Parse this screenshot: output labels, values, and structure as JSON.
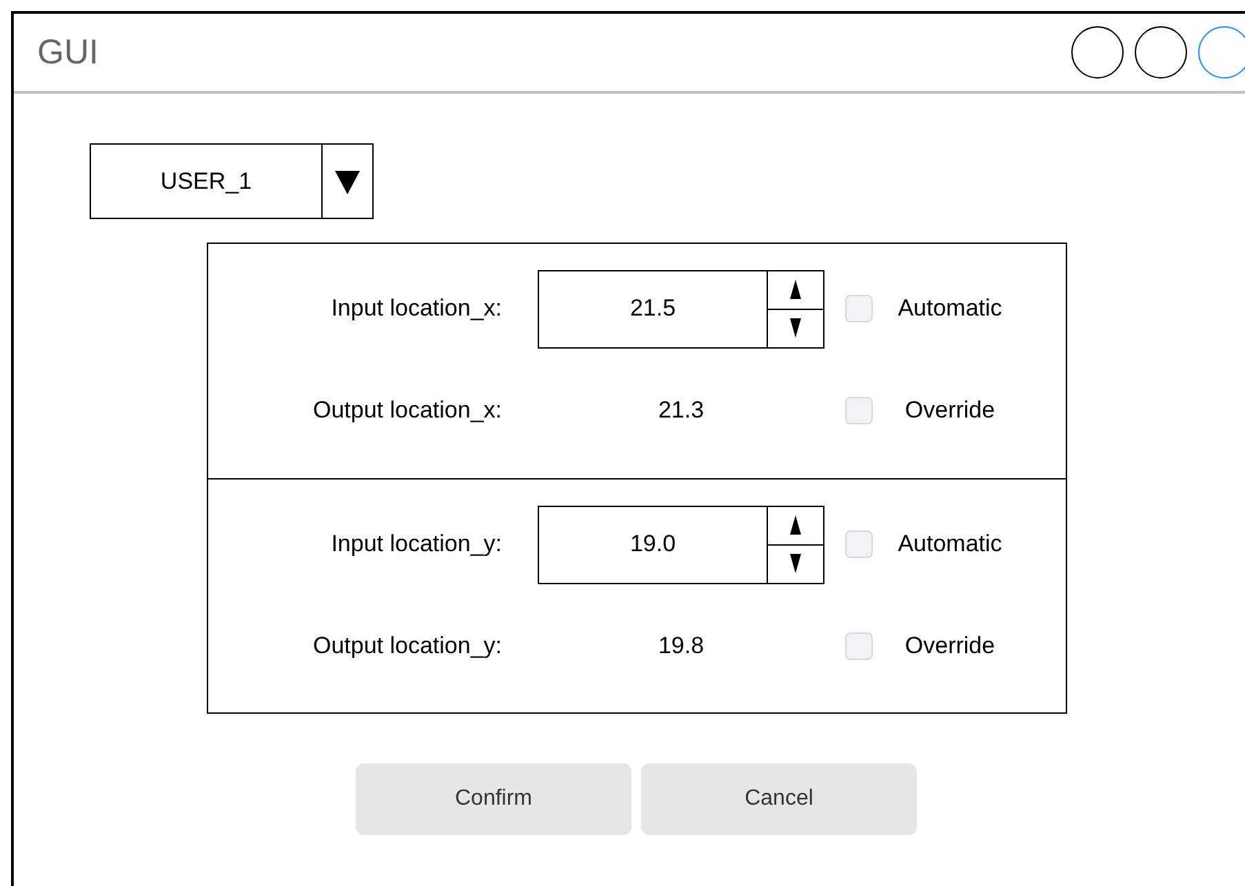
{
  "window": {
    "title": "GUI"
  },
  "user_dropdown": {
    "value": "USER_1"
  },
  "sections": [
    {
      "input": {
        "label": "Input location_x:",
        "value": "21.5"
      },
      "automatic": {
        "label": "Automatic",
        "checked": false
      },
      "output": {
        "label": "Output location_x:",
        "value": "21.3"
      },
      "override": {
        "label": "Override",
        "checked": false
      }
    },
    {
      "input": {
        "label": "Input location_y:",
        "value": "19.0"
      },
      "automatic": {
        "label": "Automatic",
        "checked": false
      },
      "output": {
        "label": "Output location_y:",
        "value": "19.8"
      },
      "override": {
        "label": "Override",
        "checked": false
      }
    }
  ],
  "buttons": [
    "Confirm",
    "Cancel"
  ]
}
